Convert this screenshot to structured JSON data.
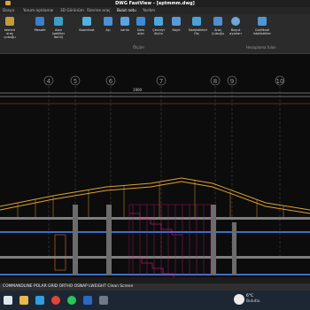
{
  "window": {
    "title": "DWG FastView - [eptmmm.dwg]"
  },
  "tabs": [
    "Dosya",
    "Yorum açıklamaı",
    "3D Görünüm",
    "Üzerine araç",
    "Bulut notu",
    "Yardım"
  ],
  "ribbon": {
    "tools": [
      {
        "label": "kemeri\naraç çubuğu",
        "icon": "toolbar-icon",
        "color": "#c89a3b"
      },
      {
        "label": "Mesafe",
        "icon": "distance-icon",
        "color": "#3b7fd0"
      },
      {
        "label": "Alan (şekiller\ndahil)",
        "icon": "area-icon",
        "color": "#3aa0c8"
      },
      {
        "label": "Koordinat",
        "icon": "coordinate-icon",
        "color": "#52b1e0"
      },
      {
        "label": "Açı",
        "icon": "angle-icon",
        "color": "#4a90d9"
      },
      {
        "label": "varlık",
        "icon": "entity-icon",
        "color": "#5aa3e0"
      },
      {
        "label": "Dolu\nalan",
        "icon": "fill-area-icon",
        "color": "#3c8bd6"
      },
      {
        "label": "Çevreyi\nölçün",
        "icon": "perimeter-icon",
        "color": "#4aa8dc"
      },
      {
        "label": "Kayıt",
        "icon": "record-icon",
        "color": "#5b9ad8"
      },
      {
        "label": "İstatistikleri\nÖlç",
        "icon": "statistics-icon",
        "color": "#49a2d6"
      },
      {
        "label": "Araç\nÇubuğu",
        "icon": "tool-bar-icon",
        "color": "#4f8fcf"
      },
      {
        "label": "Boyut\nayarları",
        "icon": "settings-icon",
        "color": "#6ea6d9"
      },
      {
        "label": "Grafiksel\nistatistikler",
        "icon": "chart-icon",
        "color": "#4e97d3"
      }
    ],
    "groups": [
      "Ölçüm",
      "Hesaplama fuları"
    ]
  },
  "drawing": {
    "grid_labels": [
      "4",
      "5",
      "6",
      "7",
      "8",
      "9",
      "10"
    ],
    "dimension_text": "1900"
  },
  "statusbar": {
    "text": "COMMANDLINE POLAR GRID ORTHO OSNAP LWEIGHT Clean Screen"
  },
  "taskbar": {
    "apps": [
      {
        "name": "search-icon",
        "color": "#dfe6ee"
      },
      {
        "name": "file-explorer-icon",
        "color": "#e9b94a"
      },
      {
        "name": "edge-icon",
        "color": "#2f9fe0"
      },
      {
        "name": "chrome-icon",
        "color": "#e3443a"
      },
      {
        "name": "whatsapp-icon",
        "color": "#2cc55b"
      },
      {
        "name": "word-icon",
        "color": "#2b67c6"
      },
      {
        "name": "app-icon",
        "color": "#6e7a88"
      }
    ],
    "weather_temp": "6°C",
    "weather_desc": "Bulutlu"
  }
}
